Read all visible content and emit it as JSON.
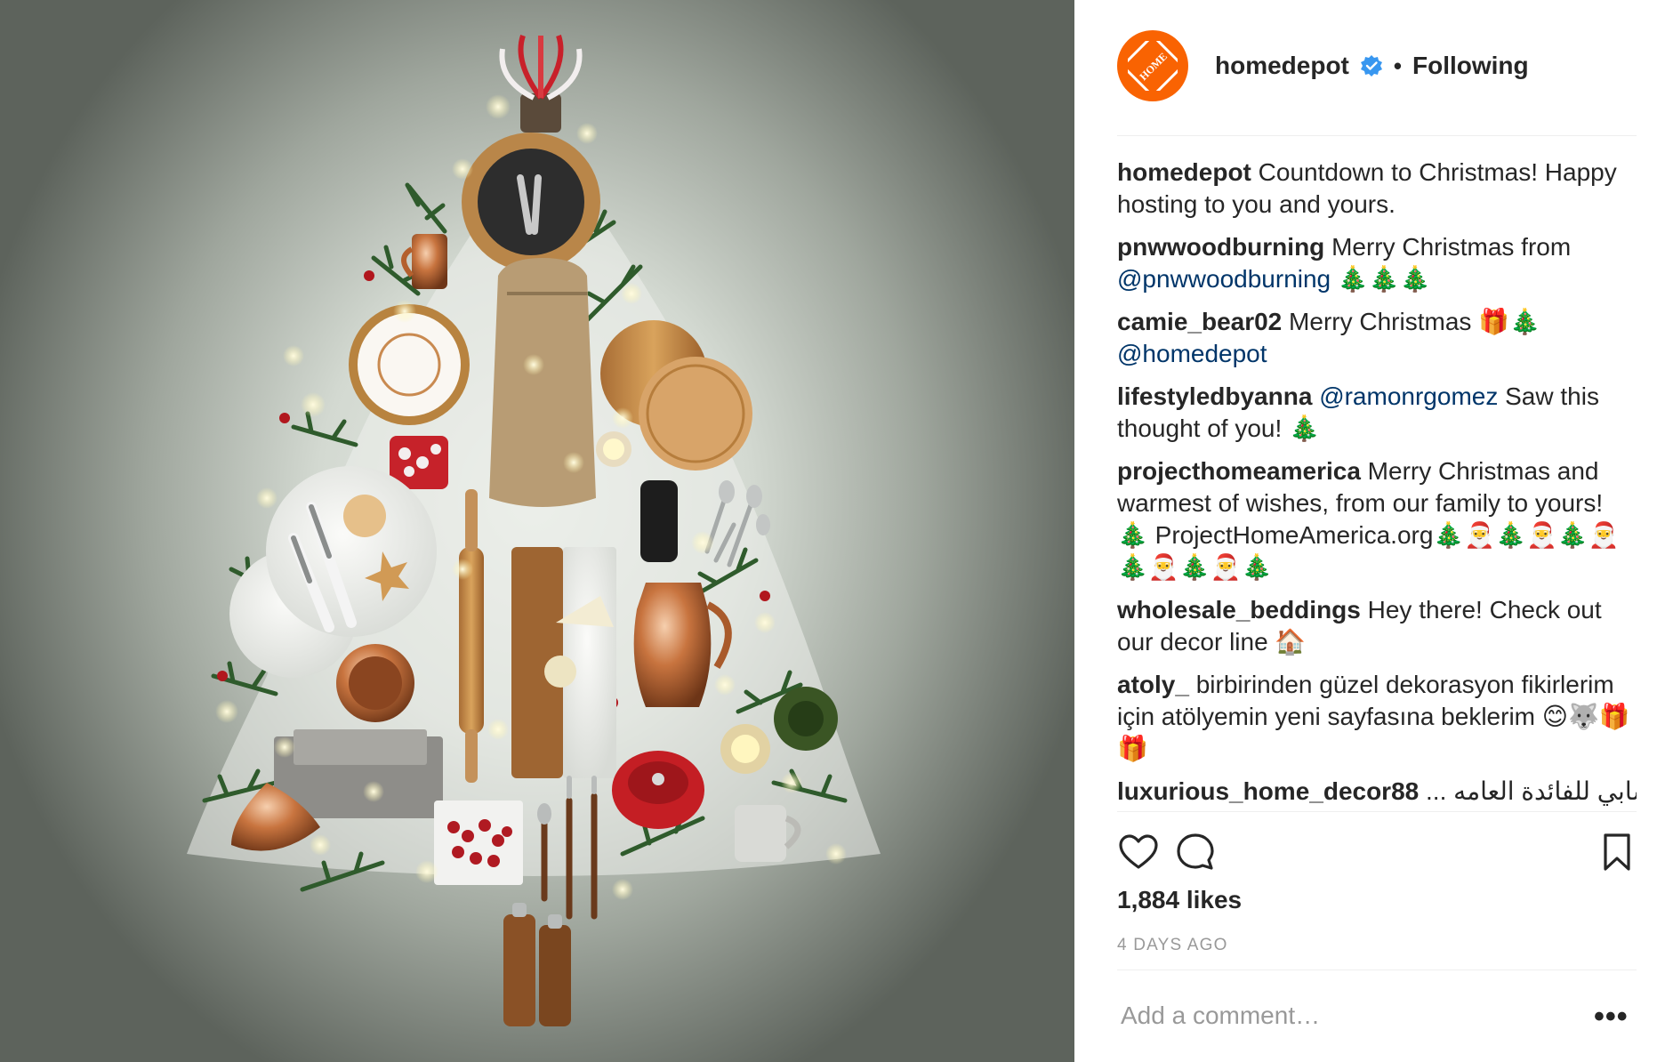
{
  "post": {
    "image_alt": "Christmas tree arrangement of kitchenware"
  },
  "header": {
    "username": "homedepot",
    "separator": "•",
    "follow_label": "Following",
    "logo_text": "THE HOME DEPOT"
  },
  "comments": [
    {
      "user": "homedepot",
      "parts": [
        {
          "t": "Countdown to Christmas! Happy hosting to you and yours."
        }
      ]
    },
    {
      "user": "pnwwoodburning",
      "parts": [
        {
          "t": "Merry Christmas from "
        },
        {
          "m": "@pnwwoodburning"
        },
        {
          "t": " 🎄🎄🎄"
        }
      ]
    },
    {
      "user": "camie_bear02",
      "parts": [
        {
          "t": "Merry Christmas 🎁🎄 "
        },
        {
          "m": "@homedepot"
        }
      ]
    },
    {
      "user": "lifestyledbyanna",
      "parts": [
        {
          "m": "@ramonrgomez"
        },
        {
          "t": " Saw this thought of you! 🎄"
        }
      ]
    },
    {
      "user": "projecthomeamerica",
      "parts": [
        {
          "t": "Merry Christmas and warmest of wishes, from our family to yours! 🎄 ProjectHomeAmerica.org🎄🎅🎄🎅🎄🎅🎄🎅🎄🎅🎄"
        }
      ]
    },
    {
      "user": "wholesale_beddings",
      "parts": [
        {
          "t": "Hey there! Check out our decor line 🏠"
        }
      ]
    },
    {
      "user": "atoly_",
      "parts": [
        {
          "t": "birbirinden güzel dekorasyon fikirlerim için atölyemin yeni sayfasına beklerim 😊🐺🎁🎁"
        }
      ]
    },
    {
      "user": "luxurious_home_decor88",
      "parts": [
        {
          "t": "... حسابي للفائدة العامه"
        }
      ]
    }
  ],
  "actions": {
    "like_icon": "heart-icon",
    "comment_icon": "speech-bubble-icon",
    "save_icon": "bookmark-icon"
  },
  "likes": "1,884 likes",
  "timestamp": "4 DAYS AGO",
  "comment_box": {
    "placeholder": "Add a comment…",
    "more_label": "•••"
  },
  "colors": {
    "brand_orange": "#f96302",
    "verified_blue": "#3897f0",
    "mention_blue": "#003569",
    "muted": "#999999"
  }
}
